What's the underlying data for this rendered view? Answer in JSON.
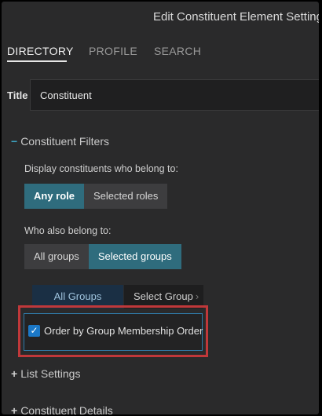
{
  "header": {
    "title": "Edit Constituent Element Settings"
  },
  "tabs": [
    {
      "label": "DIRECTORY"
    },
    {
      "label": "PROFILE"
    },
    {
      "label": "SEARCH"
    }
  ],
  "title_field": {
    "label": "Title",
    "value": "Constituent"
  },
  "constituent_filters": {
    "sign": "−",
    "heading": "Constituent Filters",
    "display_label": "Display constituents who belong to:",
    "role_options": [
      "Any role",
      "Selected roles"
    ],
    "role_selected": "Any role",
    "also_label": "Who also belong to:",
    "group_options": [
      "All groups",
      "Selected groups"
    ],
    "group_selected": "Selected groups",
    "group_tabs": {
      "all": "All Groups",
      "select": "Select Group",
      "chevron": "›"
    },
    "order_checkbox": {
      "mark": "✓",
      "label": "Order by Group Membership Order",
      "checked": true
    }
  },
  "list_settings": {
    "sign": "+",
    "heading": "List Settings"
  },
  "constituent_details": {
    "sign": "+",
    "heading": "Constituent Details"
  },
  "colors": {
    "accent": "#2f6c7d",
    "highlight": "#c0383a",
    "checkbox": "#1b78c7"
  }
}
